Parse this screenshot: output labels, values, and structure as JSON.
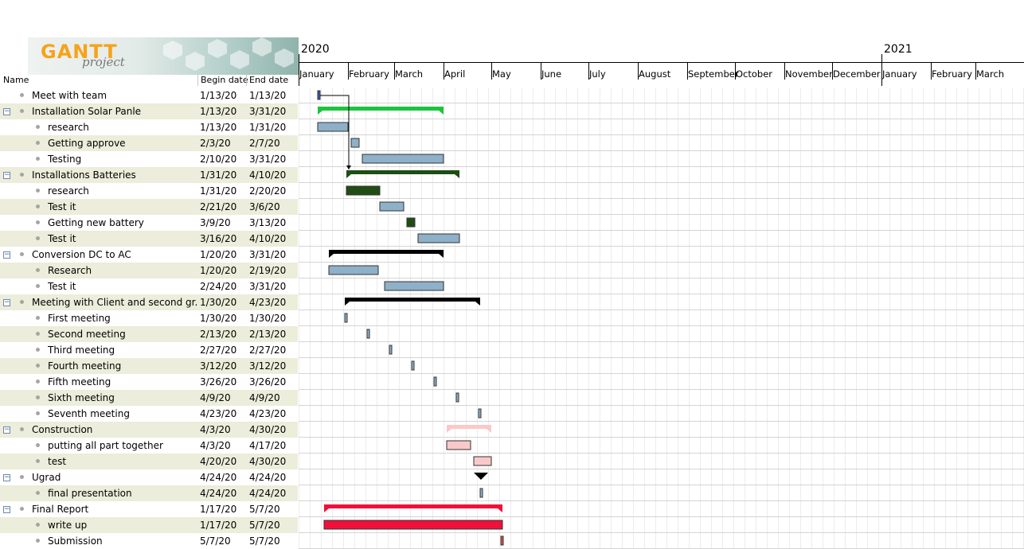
{
  "logo": {
    "title": "GANTT",
    "subtitle": "project"
  },
  "columns": {
    "name": "Name",
    "begin": "Begin date",
    "end": "End date"
  },
  "timeline": {
    "years": [
      {
        "label": "2020",
        "date": "2020-01-01"
      },
      {
        "label": "2021",
        "date": "2021-01-01"
      }
    ],
    "months": [
      {
        "label": "January",
        "date": "2020-01-01"
      },
      {
        "label": "February",
        "date": "2020-02-01"
      },
      {
        "label": "March",
        "date": "2020-03-01"
      },
      {
        "label": "April",
        "date": "2020-04-01"
      },
      {
        "label": "May",
        "date": "2020-05-01"
      },
      {
        "label": "June",
        "date": "2020-06-01"
      },
      {
        "label": "July",
        "date": "2020-07-01"
      },
      {
        "label": "August",
        "date": "2020-08-01"
      },
      {
        "label": "September",
        "date": "2020-09-01"
      },
      {
        "label": "October",
        "date": "2020-10-01"
      },
      {
        "label": "November",
        "date": "2020-11-01"
      },
      {
        "label": "December",
        "date": "2020-12-01"
      },
      {
        "label": "January",
        "date": "2021-01-01"
      },
      {
        "label": "February",
        "date": "2021-02-01"
      },
      {
        "label": "March",
        "date": "2021-03-01"
      }
    ]
  },
  "colors": {
    "default_task": "#8eb0c9",
    "dark_green": "#1f4d14",
    "bright_green": "#1cc43d",
    "black": "#000000",
    "pink": "#f9c9c9",
    "red": "#f0103a",
    "row_alt": "#ecedda"
  },
  "tasks": [
    {
      "name": "Meet with team",
      "begin": "1/13/20",
      "end": "1/13/20",
      "level": 0,
      "group": false,
      "start_date": "2020-01-13",
      "end_date": "2020-01-13",
      "kind": "milestone",
      "color": "#3a57a8"
    },
    {
      "name": "Installation Solar Panle",
      "begin": "1/13/20",
      "end": "3/31/20",
      "level": 0,
      "group": true,
      "start_date": "2020-01-13",
      "end_date": "2020-03-31",
      "kind": "summary",
      "color": "#1cc43d"
    },
    {
      "name": "research",
      "begin": "1/13/20",
      "end": "1/31/20",
      "level": 1,
      "group": false,
      "start_date": "2020-01-13",
      "end_date": "2020-01-31",
      "kind": "task",
      "color": "#8eb0c9"
    },
    {
      "name": "Getting approve",
      "begin": "2/3/20",
      "end": "2/7/20",
      "level": 1,
      "group": false,
      "start_date": "2020-02-03",
      "end_date": "2020-02-07",
      "kind": "task",
      "color": "#8eb0c9"
    },
    {
      "name": "Testing",
      "begin": "2/10/20",
      "end": "3/31/20",
      "level": 1,
      "group": false,
      "start_date": "2020-02-10",
      "end_date": "2020-03-31",
      "kind": "task",
      "color": "#8eb0c9"
    },
    {
      "name": "Installations Batteries",
      "begin": "1/31/20",
      "end": "4/10/20",
      "level": 0,
      "group": true,
      "start_date": "2020-01-31",
      "end_date": "2020-04-10",
      "kind": "summary",
      "color": "#1f4d14"
    },
    {
      "name": "research",
      "begin": "1/31/20",
      "end": "2/20/20",
      "level": 1,
      "group": false,
      "start_date": "2020-01-31",
      "end_date": "2020-02-20",
      "kind": "task",
      "color": "#1f4d14"
    },
    {
      "name": "Test it",
      "begin": "2/21/20",
      "end": "3/6/20",
      "level": 1,
      "group": false,
      "start_date": "2020-02-21",
      "end_date": "2020-03-06",
      "kind": "task",
      "color": "#8eb0c9"
    },
    {
      "name": "Getting new battery",
      "begin": "3/9/20",
      "end": "3/13/20",
      "level": 1,
      "group": false,
      "start_date": "2020-03-09",
      "end_date": "2020-03-13",
      "kind": "task",
      "color": "#1f4d14"
    },
    {
      "name": "Test it",
      "begin": "3/16/20",
      "end": "4/10/20",
      "level": 1,
      "group": false,
      "start_date": "2020-03-16",
      "end_date": "2020-04-10",
      "kind": "task",
      "color": "#8eb0c9"
    },
    {
      "name": "Conversion DC to AC",
      "begin": "1/20/20",
      "end": "3/31/20",
      "level": 0,
      "group": true,
      "start_date": "2020-01-20",
      "end_date": "2020-03-31",
      "kind": "summary",
      "color": "#000000"
    },
    {
      "name": "Research",
      "begin": "1/20/20",
      "end": "2/19/20",
      "level": 1,
      "group": false,
      "start_date": "2020-01-20",
      "end_date": "2020-02-19",
      "kind": "task",
      "color": "#8eb0c9"
    },
    {
      "name": "Test it",
      "begin": "2/24/20",
      "end": "3/31/20",
      "level": 1,
      "group": false,
      "start_date": "2020-02-24",
      "end_date": "2020-03-31",
      "kind": "task",
      "color": "#8eb0c9"
    },
    {
      "name": "Meeting with Client and second gr...",
      "begin": "1/30/20",
      "end": "4/23/20",
      "level": 0,
      "group": true,
      "start_date": "2020-01-30",
      "end_date": "2020-04-23",
      "kind": "summary",
      "color": "#000000"
    },
    {
      "name": "First meeting",
      "begin": "1/30/20",
      "end": "1/30/20",
      "level": 1,
      "group": false,
      "start_date": "2020-01-30",
      "end_date": "2020-01-30",
      "kind": "milestone",
      "color": "#8eb0c9"
    },
    {
      "name": "Second meeting",
      "begin": "2/13/20",
      "end": "2/13/20",
      "level": 1,
      "group": false,
      "start_date": "2020-02-13",
      "end_date": "2020-02-13",
      "kind": "milestone",
      "color": "#8eb0c9"
    },
    {
      "name": "Third meeting",
      "begin": "2/27/20",
      "end": "2/27/20",
      "level": 1,
      "group": false,
      "start_date": "2020-02-27",
      "end_date": "2020-02-27",
      "kind": "milestone",
      "color": "#8eb0c9"
    },
    {
      "name": "Fourth meeting",
      "begin": "3/12/20",
      "end": "3/12/20",
      "level": 1,
      "group": false,
      "start_date": "2020-03-12",
      "end_date": "2020-03-12",
      "kind": "milestone",
      "color": "#8eb0c9"
    },
    {
      "name": "Fifth meeting",
      "begin": "3/26/20",
      "end": "3/26/20",
      "level": 1,
      "group": false,
      "start_date": "2020-03-26",
      "end_date": "2020-03-26",
      "kind": "milestone",
      "color": "#8eb0c9"
    },
    {
      "name": "Sixth meeting",
      "begin": "4/9/20",
      "end": "4/9/20",
      "level": 1,
      "group": false,
      "start_date": "2020-04-09",
      "end_date": "2020-04-09",
      "kind": "milestone",
      "color": "#8eb0c9"
    },
    {
      "name": "Seventh meeting",
      "begin": "4/23/20",
      "end": "4/23/20",
      "level": 1,
      "group": false,
      "start_date": "2020-04-23",
      "end_date": "2020-04-23",
      "kind": "milestone",
      "color": "#8eb0c9"
    },
    {
      "name": "Construction",
      "begin": "4/3/20",
      "end": "4/30/20",
      "level": 0,
      "group": true,
      "start_date": "2020-04-03",
      "end_date": "2020-04-30",
      "kind": "summary",
      "color": "#f9c9c9"
    },
    {
      "name": "putting all part together",
      "begin": "4/3/20",
      "end": "4/17/20",
      "level": 1,
      "group": false,
      "start_date": "2020-04-03",
      "end_date": "2020-04-17",
      "kind": "task",
      "color": "#f9c9c9"
    },
    {
      "name": "test",
      "begin": "4/20/20",
      "end": "4/30/20",
      "level": 1,
      "group": false,
      "start_date": "2020-04-20",
      "end_date": "2020-04-30",
      "kind": "task",
      "color": "#f9c9c9"
    },
    {
      "name": "Ugrad",
      "begin": "4/24/20",
      "end": "4/24/20",
      "level": 0,
      "group": true,
      "start_date": "2020-04-24",
      "end_date": "2020-04-24",
      "kind": "summary-milestone",
      "color": "#000000"
    },
    {
      "name": "final presentation",
      "begin": "4/24/20",
      "end": "4/24/20",
      "level": 1,
      "group": false,
      "start_date": "2020-04-24",
      "end_date": "2020-04-24",
      "kind": "milestone",
      "color": "#8eb0c9"
    },
    {
      "name": "Final Report",
      "begin": "1/17/20",
      "end": "5/7/20",
      "level": 0,
      "group": true,
      "start_date": "2020-01-17",
      "end_date": "2020-05-07",
      "kind": "summary",
      "color": "#f0103a"
    },
    {
      "name": "write up",
      "begin": "1/17/20",
      "end": "5/7/20",
      "level": 1,
      "group": false,
      "start_date": "2020-01-17",
      "end_date": "2020-05-07",
      "kind": "task",
      "color": "#f0103a"
    },
    {
      "name": "Submission",
      "begin": "5/7/20",
      "end": "5/7/20",
      "level": 1,
      "group": false,
      "start_date": "2020-05-07",
      "end_date": "2020-05-07",
      "kind": "milestone",
      "color": "#d85050"
    }
  ],
  "dependencies": [
    {
      "from": 0,
      "to": 5
    }
  ]
}
